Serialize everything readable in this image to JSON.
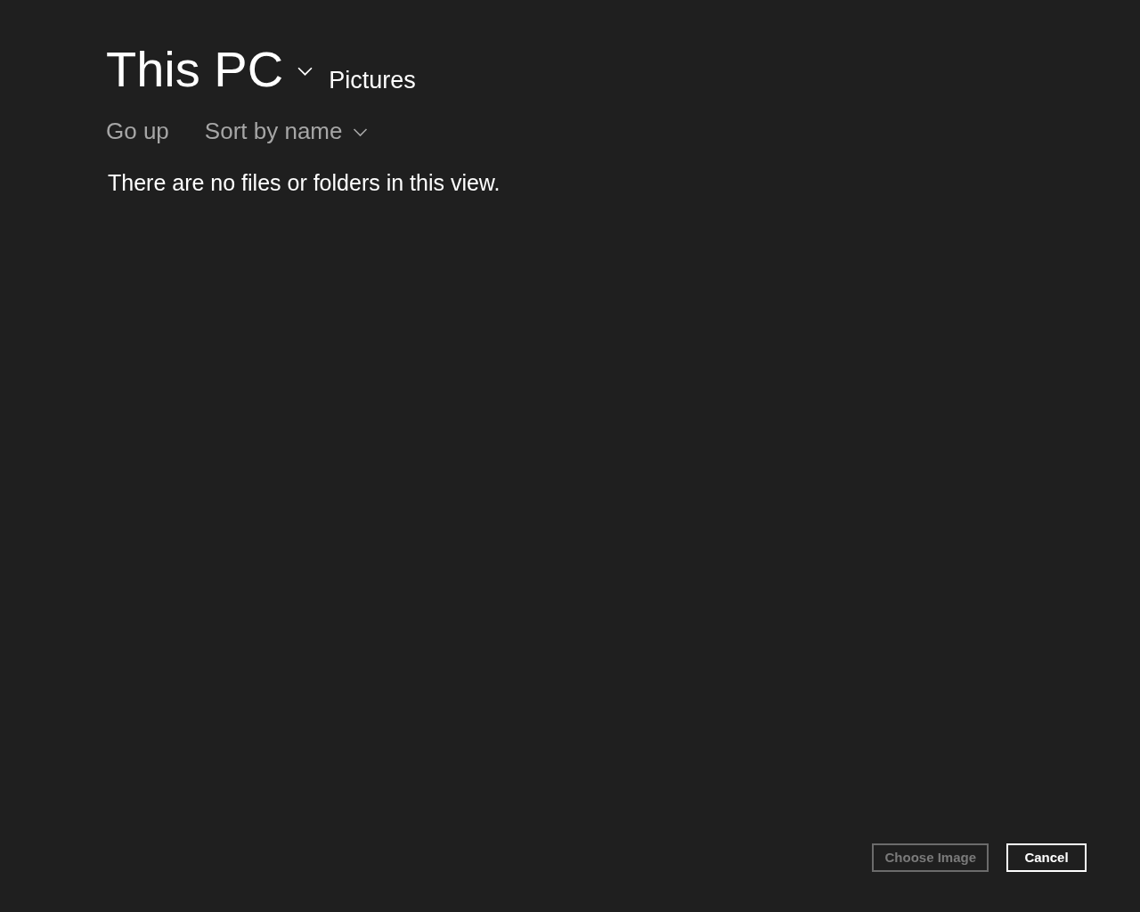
{
  "header": {
    "location": "This PC",
    "folder": "Pictures"
  },
  "toolbar": {
    "go_up": "Go up",
    "sort": "Sort by name"
  },
  "empty_message": "There are no files or folders in this view.",
  "buttons": [
    {
      "label": "Choose Image",
      "disabled": true
    },
    {
      "label": "Cancel",
      "disabled": false
    }
  ]
}
